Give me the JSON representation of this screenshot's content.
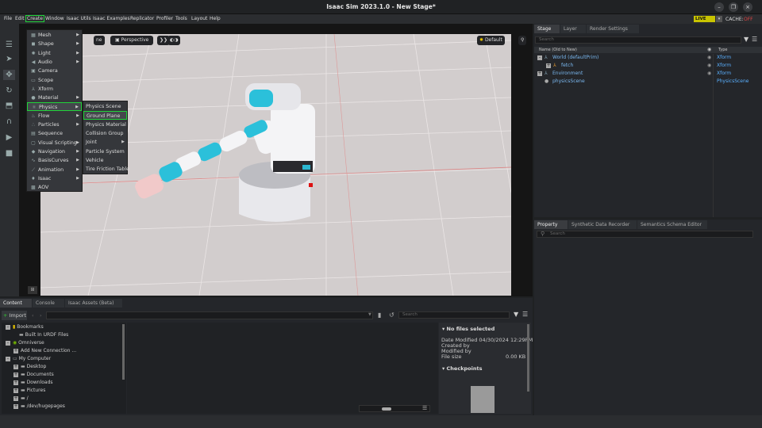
{
  "window": {
    "title": "Isaac Sim 2023.1.0 - New Stage*",
    "minimize": "–",
    "maximize": "❐",
    "close": "×"
  },
  "menubar": {
    "items": [
      "File",
      "Edit",
      "Create",
      "Window",
      "Isaac Utils",
      "Isaac Examples",
      "Replicator",
      "Profiler",
      "Tools",
      "Layout",
      "Help"
    ],
    "live": "LIVE",
    "cache_label": "CACHE:",
    "cache_state": "OFF"
  },
  "create_menu": [
    {
      "label": "Mesh",
      "icon": "mesh-icon",
      "glyph": "▦",
      "submenu": true
    },
    {
      "label": "Shape",
      "icon": "shape-icon",
      "glyph": "◼",
      "submenu": true
    },
    {
      "label": "Light",
      "icon": "light-icon",
      "glyph": "✺",
      "submenu": true
    },
    {
      "label": "Audio",
      "icon": "audio-icon",
      "glyph": "◀",
      "submenu": true
    },
    {
      "label": "Camera",
      "icon": "camera-icon",
      "glyph": "▣",
      "submenu": false
    },
    {
      "label": "Scope",
      "icon": "scope-icon",
      "glyph": "▭",
      "submenu": false
    },
    {
      "label": "Xform",
      "icon": "xform-icon",
      "glyph": "⅄",
      "submenu": false
    },
    {
      "label": "Material",
      "icon": "material-icon",
      "glyph": "●",
      "submenu": true
    },
    {
      "label": "Physics",
      "icon": "physics-icon",
      "glyph": "⚛",
      "submenu": true
    },
    {
      "label": "Flow",
      "icon": "flow-icon",
      "glyph": "♨",
      "submenu": true
    },
    {
      "label": "Particles",
      "icon": "particles-icon",
      "glyph": "∴",
      "submenu": true
    },
    {
      "label": "Sequence",
      "icon": "sequence-icon",
      "glyph": "▤",
      "submenu": false
    },
    {
      "label": "Visual Scripting",
      "icon": "visual-scripting-icon",
      "glyph": "▢",
      "submenu": true
    },
    {
      "label": "Navigation",
      "icon": "navigation-icon",
      "glyph": "◆",
      "submenu": true
    },
    {
      "label": "BasisCurves",
      "icon": "basis-curves-icon",
      "glyph": "∿",
      "submenu": true
    },
    {
      "label": "Animation",
      "icon": "animation-icon",
      "glyph": "⟋",
      "submenu": true
    },
    {
      "label": "Isaac",
      "icon": "isaac-icon",
      "glyph": "♦",
      "submenu": true
    },
    {
      "label": "AOV",
      "icon": "aov-icon",
      "glyph": "▩",
      "submenu": false
    }
  ],
  "physics_submenu": [
    {
      "label": "Physics Scene",
      "submenu": false
    },
    {
      "label": "Ground Plane",
      "submenu": false
    },
    {
      "label": "Physics Material",
      "submenu": false
    },
    {
      "label": "Collision Group",
      "submenu": false
    },
    {
      "label": "Joint",
      "submenu": true
    },
    {
      "label": "Particle System",
      "submenu": false
    },
    {
      "label": "Vehicle",
      "submenu": false
    },
    {
      "label": "Tire Friction Table",
      "submenu": false
    }
  ],
  "viewport": {
    "camera": "Perspective",
    "lighting": "Default",
    "corner_badge": "⊞",
    "fps_btn": "ne"
  },
  "stage": {
    "tabs": [
      "Stage",
      "Layer",
      "Render Settings"
    ],
    "search_placeholder": "Search",
    "col_name": "Name (Old to New)",
    "col_type": "Type",
    "rows": [
      {
        "name": "World (defaultPrim)",
        "type": "Xform"
      },
      {
        "name": "fetch",
        "type": "Xform"
      },
      {
        "name": "Environment",
        "type": "Xform"
      },
      {
        "name": "physicsScene",
        "type": "PhysicsScene"
      }
    ]
  },
  "property": {
    "tabs": [
      "Property",
      "Synthetic Data Recorder",
      "Semantics Schema Editor"
    ],
    "search_placeholder": "Search"
  },
  "content": {
    "tabs": [
      "Content",
      "Console",
      "Isaac Assets (Beta)"
    ],
    "import_label": "Import",
    "search_placeholder": "Search",
    "tree": [
      {
        "label": "Bookmarks",
        "level": 0
      },
      {
        "label": "Built In URDF Files",
        "level": 1
      },
      {
        "label": "Omniverse",
        "level": 0
      },
      {
        "label": "Add New Connection ...",
        "level": 1
      },
      {
        "label": "My Computer",
        "level": 0
      },
      {
        "label": "Desktop",
        "level": 1
      },
      {
        "label": "Documents",
        "level": 1
      },
      {
        "label": "Downloads",
        "level": 1
      },
      {
        "label": "Pictures",
        "level": 1
      },
      {
        "label": "/",
        "level": 1
      },
      {
        "label": "/dev/hugepages",
        "level": 1
      }
    ],
    "details": {
      "header": "No files selected",
      "date_label": "Date Modified",
      "date_value": "04/30/2024 12:29PM",
      "created_label": "Created by",
      "modified_label": "Modified by",
      "size_label": "File size",
      "size_value": "0.00 KB",
      "checkpoints": "Checkpoints"
    }
  }
}
